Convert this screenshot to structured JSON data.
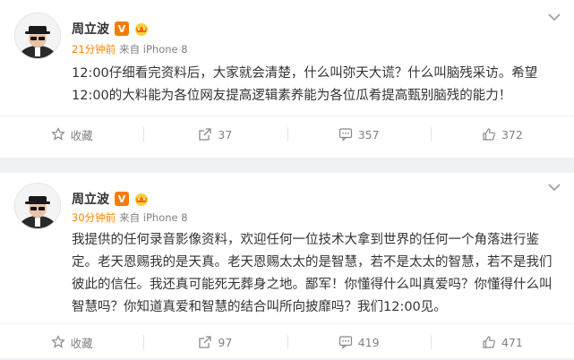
{
  "posts": [
    {
      "author": "周立波",
      "verified_badge": "V",
      "time": "21分钟前",
      "source": "来自 iPhone 8",
      "text": "12:00仔细看完资料后，大家就会清楚，什么叫弥天大谎？什么叫脑残采访。希望12:00的大料能为各位网友提高逻辑素养能为各位瓜肴提高甄别脑残的能力！",
      "actions": {
        "favorite": "收藏",
        "repost": "37",
        "comment": "357",
        "like": "372"
      }
    },
    {
      "author": "周立波",
      "verified_badge": "V",
      "time": "30分钟前",
      "source": "来自 iPhone 8",
      "text": "我提供的任何录音影像资料，欢迎任何一位技术大拿到世界的任何一个角落进行鉴定。老天恩赐我的是天真。老天恩赐太太的是智慧，若不是太太的智慧，若不是我们彼此的信任。我还真可能死无葬身之地。鄙军！你懂得什么叫真爱吗？你懂得什么叫智慧吗？你知道真爱和智慧的结合叫所向披靡吗？我们12:00见。",
      "actions": {
        "favorite": "收藏",
        "repost": "97",
        "comment": "419",
        "like": "471"
      }
    }
  ],
  "icons": {
    "avatar": "avatar-man-with-hat-sunglasses",
    "vip": "vip-crown-icon",
    "more": "chevron-down-icon",
    "favorite": "star-icon",
    "repost": "share-arrow-icon",
    "comment": "comment-icon",
    "like": "thumbs-up-icon"
  },
  "colors": {
    "accent_orange": "#ff8200",
    "badge": "#f27c00",
    "text": "#333333",
    "muted": "#808080"
  }
}
